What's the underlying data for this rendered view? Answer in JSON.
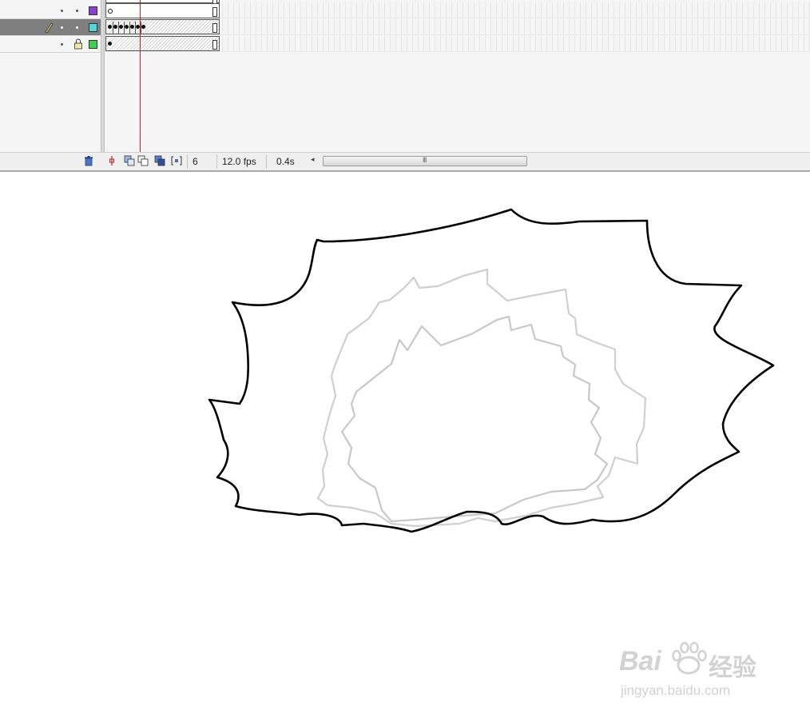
{
  "timeline": {
    "layers": [
      {
        "color": "#8a3fd0",
        "state": "normal"
      },
      {
        "color": "#4fd8d8",
        "state": "selected",
        "icon": "pencil-icon"
      },
      {
        "color": "#3fd04f",
        "state": "locked",
        "icon": "lock-icon"
      }
    ],
    "status": {
      "current_frame": "6",
      "frame_rate": "12.0 fps",
      "elapsed_time": "0.4s",
      "scroll_grip": "III",
      "scroll_left_arrow": "◂"
    }
  },
  "watermark": {
    "brand_left": "Bai",
    "brand_right": "经验",
    "url": "jingyan.baidu.com"
  }
}
